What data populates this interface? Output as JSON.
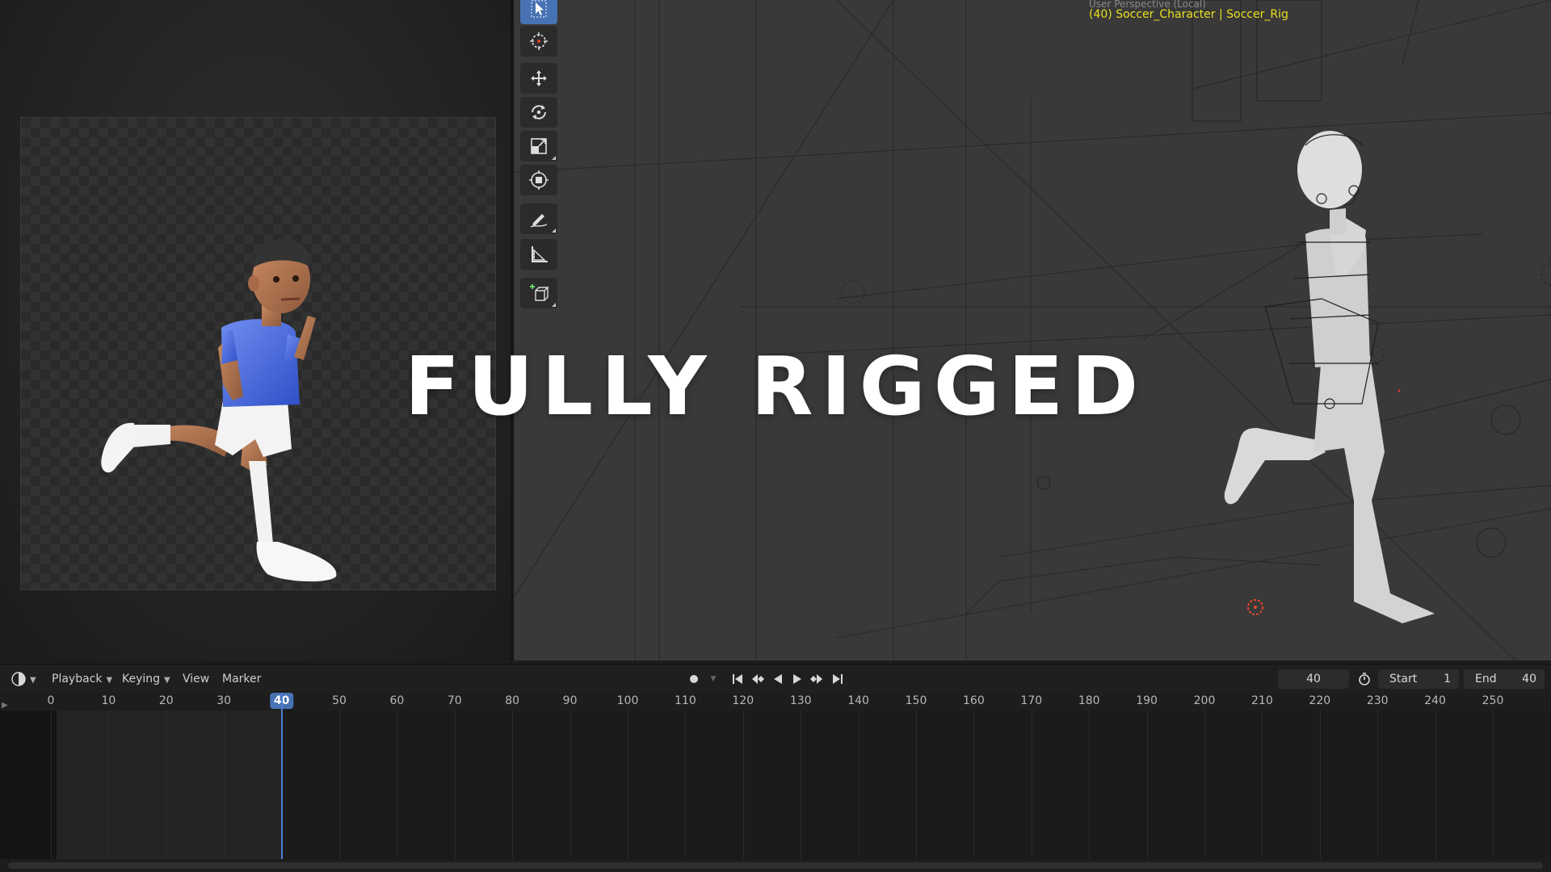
{
  "viewport": {
    "info_line": "(40) Soccer_Character | Soccer_Rig",
    "info_subline": "User Perspective (Local)"
  },
  "overlay": {
    "caption": "FULLY RIGGED"
  },
  "toolbar": {
    "tools": [
      {
        "name": "select-box-tool",
        "icon": "select-cursor-icon",
        "active": true
      },
      {
        "name": "cursor-tool",
        "icon": "3d-cursor-icon",
        "active": false
      },
      {
        "name": "move-tool",
        "icon": "move-arrows-icon",
        "active": false
      },
      {
        "name": "rotate-tool",
        "icon": "rotate-icon",
        "active": false
      },
      {
        "name": "scale-tool",
        "icon": "scale-icon",
        "active": false
      },
      {
        "name": "transform-tool",
        "icon": "transform-icon",
        "active": false
      },
      {
        "name": "annotate-tool",
        "icon": "pencil-annotate-icon",
        "active": false
      },
      {
        "name": "measure-tool",
        "icon": "ruler-measure-icon",
        "active": false
      },
      {
        "name": "add-cube-tool",
        "icon": "add-cube-icon",
        "active": false
      }
    ]
  },
  "timeline": {
    "header": {
      "editor_type_icon": "clock-editor-icon",
      "menus": [
        "Playback",
        "Keying",
        "View",
        "Marker"
      ],
      "current_frame": "40",
      "start_label": "Start",
      "start_value": "1",
      "end_label": "End",
      "end_value": "40"
    },
    "playback_buttons": [
      "record-icon",
      "jump-to-start-icon",
      "jump-to-keyframe-prev-icon",
      "play-reverse-icon",
      "play-icon",
      "jump-to-keyframe-next-icon",
      "jump-to-end-icon"
    ],
    "ticks": [
      "0",
      "10",
      "20",
      "30",
      "40",
      "50",
      "60",
      "70",
      "80",
      "90",
      "100",
      "110",
      "120",
      "130",
      "140",
      "150",
      "160",
      "170",
      "180",
      "190",
      "200",
      "210",
      "220",
      "230",
      "240",
      "250"
    ],
    "current_frame_badge": "40"
  },
  "colors": {
    "accent": "#4772b3",
    "viewport_bg": "#393939",
    "info_text": "#e8e020",
    "jersey": "#3d5ed8"
  }
}
